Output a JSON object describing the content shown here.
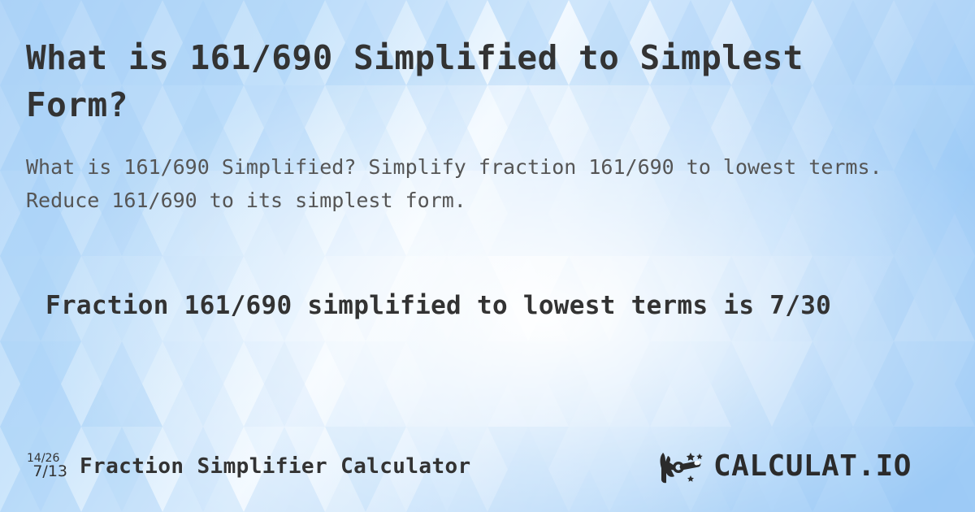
{
  "page": {
    "title": "What is 161/690 Simplified to Simplest Form?",
    "subtitle": "What is 161/690 Simplified? Simplify fraction 161/690 to lowest terms. Reduce 161/690 to its simplest form.",
    "result": "Fraction 161/690 simplified to lowest terms is 7/30"
  },
  "fraction": {
    "numerator": "161",
    "denominator": "690",
    "original": "161/690",
    "simplified": "7/30",
    "simplified_numerator": "7",
    "simplified_denominator": "30"
  },
  "footer": {
    "icon": {
      "name": "fraction-reduce-icon",
      "top": "14/26",
      "bottom": "7/13"
    },
    "label": "Fraction Simplifier Calculator",
    "logo": {
      "mark": "magic-wand-hand-icon",
      "wordmark": "CALCULAT.IO"
    }
  },
  "colors": {
    "text_dark": "#333333",
    "text_muted": "#555555",
    "bg_blue_mid": "#a8d0f5",
    "bg_blue_light": "#cfe6fb",
    "bg_blue_pale": "#eaf4fe",
    "bg_white": "#f8fcff",
    "bg_blue_deep": "#93c6f5"
  }
}
